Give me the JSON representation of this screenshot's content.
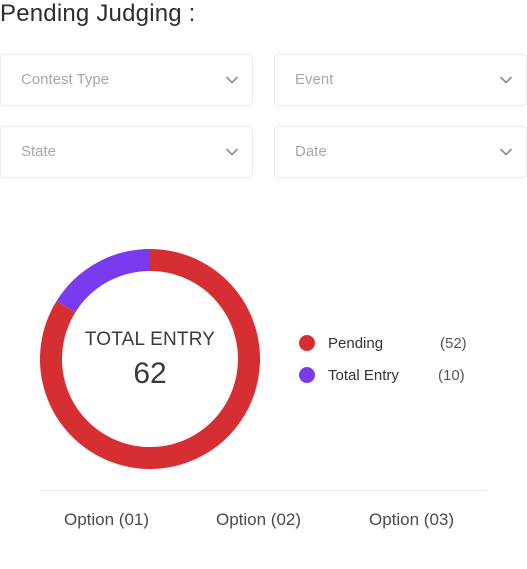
{
  "header": {
    "title": "Pending Judging :"
  },
  "filters": {
    "contest_type": {
      "placeholder": "Contest Type",
      "icon": "chevron-down-icon"
    },
    "event": {
      "placeholder": "Event",
      "icon": "chevron-down-icon"
    },
    "state": {
      "placeholder": "State",
      "icon": "chevron-down-icon"
    },
    "date": {
      "placeholder": "Date",
      "icon": "chevron-down-icon"
    }
  },
  "chart_data": {
    "type": "pie",
    "center_label": "TOTAL ENTRY",
    "center_value": "62",
    "series": [
      {
        "name": "Pending",
        "value": 52,
        "value_label": "(52)",
        "color": "#d62f33"
      },
      {
        "name": "Total Entry",
        "value": 10,
        "value_label": "(10)",
        "color": "#7a3bef"
      }
    ],
    "legend_position": "right"
  },
  "options": [
    "Option (01)",
    "Option (02)",
    "Option (03)"
  ]
}
